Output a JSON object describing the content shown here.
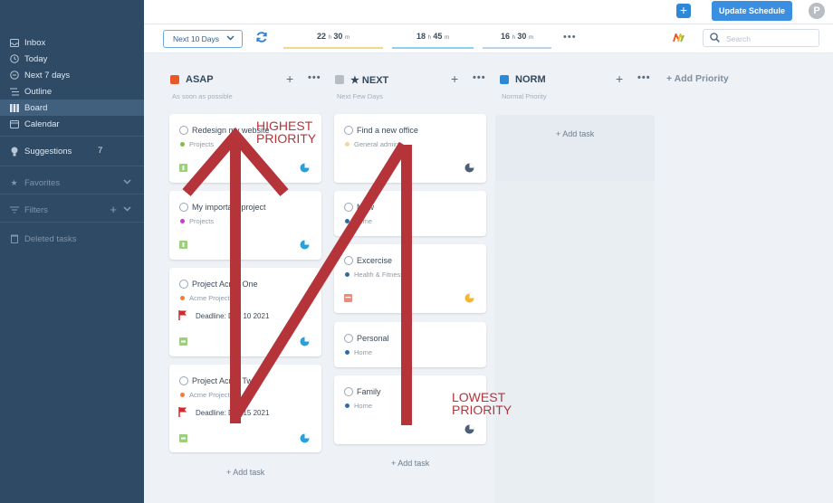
{
  "sidebar": {
    "items": [
      {
        "label": "Inbox",
        "icon": "inbox-icon"
      },
      {
        "label": "Today",
        "icon": "today-icon"
      },
      {
        "label": "Next 7 days",
        "icon": "calendar-week-icon"
      },
      {
        "label": "Outline",
        "icon": "outline-icon"
      },
      {
        "label": "Board",
        "icon": "board-icon"
      },
      {
        "label": "Calendar",
        "icon": "calendar-icon"
      }
    ],
    "suggestions": {
      "label": "Suggestions",
      "count": "7"
    },
    "favorites": "Favorites",
    "filters": "Filters",
    "deleted": "Deleted tasks"
  },
  "topbar": {
    "update_label": "Update Schedule",
    "avatar_letter": "P"
  },
  "toolbar": {
    "range_label": "Next 10 Days",
    "durations": [
      {
        "hours": "22",
        "minutes": "30",
        "h": "h",
        "m": "m",
        "color": "#f1d98a"
      },
      {
        "hours": "18",
        "minutes": "45",
        "h": "h",
        "m": "m",
        "color": "#8fd0ea"
      },
      {
        "hours": "16",
        "minutes": "30",
        "h": "h",
        "m": "m",
        "color": "#bcd2ea"
      }
    ],
    "search_placeholder": "Search"
  },
  "board": {
    "add_priority": "+ Add Priority",
    "columns": [
      {
        "title": "ASAP",
        "subtitle": "As soon as possible",
        "color": "#e95a2b",
        "add_task": "+ Add task",
        "cards": [
          {
            "title": "Redesign my website",
            "project": "Projects",
            "dot": "#7ac143"
          },
          {
            "title": "My important project",
            "project": "Projects",
            "dot": "#c23ecf"
          },
          {
            "title": "Project Acme One",
            "project": "Acme Projects",
            "dot": "#ef7d3a",
            "deadline": "Deadline: Dec 10 2021"
          },
          {
            "title": "Project Acme Two",
            "project": "Acme Projects",
            "dot": "#ef7d3a",
            "deadline": "Deadline: Dec 15 2021"
          }
        ]
      },
      {
        "title": "★ NEXT",
        "subtitle": "Next Few Days",
        "color": "#b5bcc4",
        "add_task": "+ Add task",
        "cards": [
          {
            "title": "Find a new office",
            "project": "General admin",
            "dot": "#f6d98e"
          },
          {
            "title": "Mow",
            "project": "Home",
            "dot": "#2b6cb0"
          },
          {
            "title": "Excercise",
            "project": "Health & Fitness",
            "dot": "#2b6cb0"
          },
          {
            "title": "Personal",
            "project": "Home",
            "dot": "#2b6cb0"
          },
          {
            "title": "Family",
            "project": "Home",
            "dot": "#2b6cb0"
          }
        ]
      },
      {
        "title": "NORM",
        "subtitle": "Normal Priority",
        "color": "#2e88d8",
        "add_task": "+ Add task"
      }
    ]
  },
  "annotations": {
    "highest": [
      "HIGHEST",
      "PRIORITY"
    ],
    "lowest": [
      "LOWEST",
      "PRIORITY"
    ]
  }
}
